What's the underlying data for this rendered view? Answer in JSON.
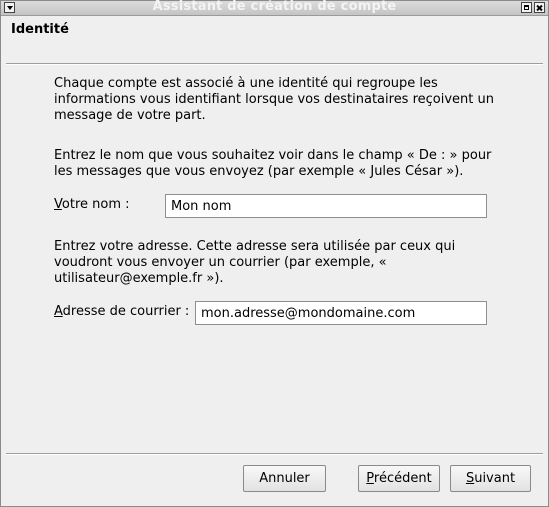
{
  "window": {
    "title": "Assistant de création de compte"
  },
  "page": {
    "title": "Identité"
  },
  "intro": "Chaque compte est associé à une identité qui regroupe les informations vous identifiant lorsque vos destinataires reçoivent un message de votre part.",
  "name_instructions": "Entrez le nom que vous souhaitez voir dans le champ « De : » pour les messages que vous envoyez (par exemple « Jules César »).",
  "name_field": {
    "label_mnemonic": "V",
    "label_rest": "otre nom :",
    "value": "Mon nom"
  },
  "email_instructions": "Entrez votre adresse. Cette adresse sera utilisée par ceux qui voudront vous envoyer un courrier (par exemple, « utilisateur@exemple.fr »).",
  "email_field": {
    "label_mnemonic": "A",
    "label_rest": "dresse de courrier :",
    "value": "mon.adresse@mondomaine.com"
  },
  "buttons": {
    "cancel": "Annuler",
    "back_mnemonic": "P",
    "back_rest": "récédent",
    "next_mnemonic": "S",
    "next_rest": "uivant"
  },
  "icons": {
    "window_menu": "chevron-down-icon",
    "maximize": "maximize-icon",
    "close": "close-icon"
  }
}
